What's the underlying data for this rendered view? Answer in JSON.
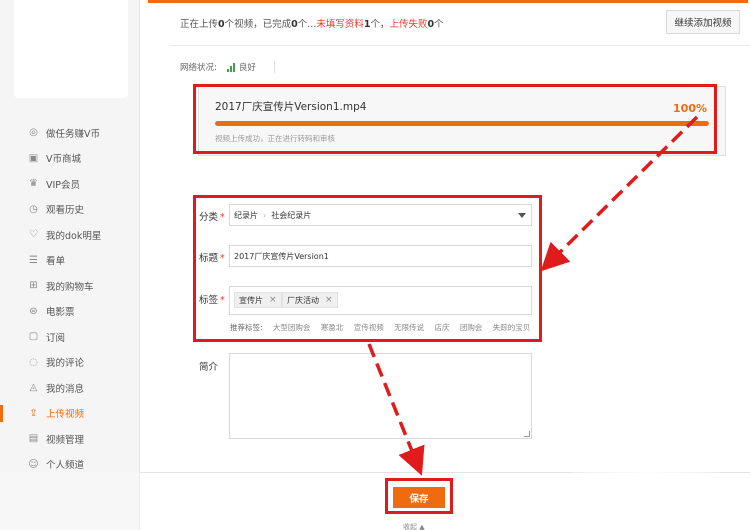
{
  "sidebar": {
    "items": [
      {
        "icon": "coin-task-icon",
        "label": "做任务赚V币"
      },
      {
        "icon": "vcoin-mall-icon",
        "label": "V币商城"
      },
      {
        "icon": "crown-icon",
        "label": "VIP会员"
      },
      {
        "icon": "clock-icon",
        "label": "观看历史"
      },
      {
        "icon": "heart-icon",
        "label": "我的dok明星"
      },
      {
        "icon": "list-icon",
        "label": "看单"
      },
      {
        "icon": "cart-icon",
        "label": "我的购物车"
      },
      {
        "icon": "film-ticket-icon",
        "label": "电影票"
      },
      {
        "icon": "subscribe-icon",
        "label": "订阅"
      },
      {
        "icon": "comment-icon",
        "label": "我的评论"
      },
      {
        "icon": "bell-icon",
        "label": "我的消息"
      },
      {
        "icon": "upload-icon",
        "label": "上传视频",
        "active": true
      },
      {
        "icon": "video-manage-icon",
        "label": "视频管理"
      },
      {
        "icon": "person-icon",
        "label": "个人频道"
      }
    ]
  },
  "status": {
    "prefix": "正在上传",
    "uploading": "0",
    "mid1": "个视频，已完成",
    "done": "0",
    "mid2": "个...",
    "missing_text": "未填写资料",
    "missing": "1",
    "mid3": "个，",
    "failed_text": "上传失败",
    "failed": "0",
    "suffix": "个",
    "add_button": "继续添加视频"
  },
  "network": {
    "label": "网络状况:",
    "value": "良好"
  },
  "upload": {
    "file_name": "2017厂庆宣传片Version1.mp4",
    "progress_text": "100%",
    "progress": 1.0,
    "note": "视频上传成功，正在进行转码和审核"
  },
  "form": {
    "category_label": "分类",
    "category_primary": "纪录片",
    "category_secondary": "社会纪录片",
    "title_label": "标题",
    "title_value": "2017厂庆宣传片Version1",
    "tags_label": "标签",
    "tags": [
      "宣传片",
      "厂庆活动"
    ],
    "recommend_label": "推荐标签:",
    "recommend_tags": [
      "大型团购会",
      "寒盈北",
      "宣传视频",
      "无限传说",
      "店庆",
      "团购会",
      "失踪的宝贝"
    ],
    "intro_label": "简介",
    "required_mark": "*"
  },
  "footer": {
    "save_label": "保存",
    "collapse_label": "收起 ▲"
  },
  "colors": {
    "accent": "#f06a0f",
    "annotation": "#e01b1b",
    "signal": "#3aa54a"
  }
}
